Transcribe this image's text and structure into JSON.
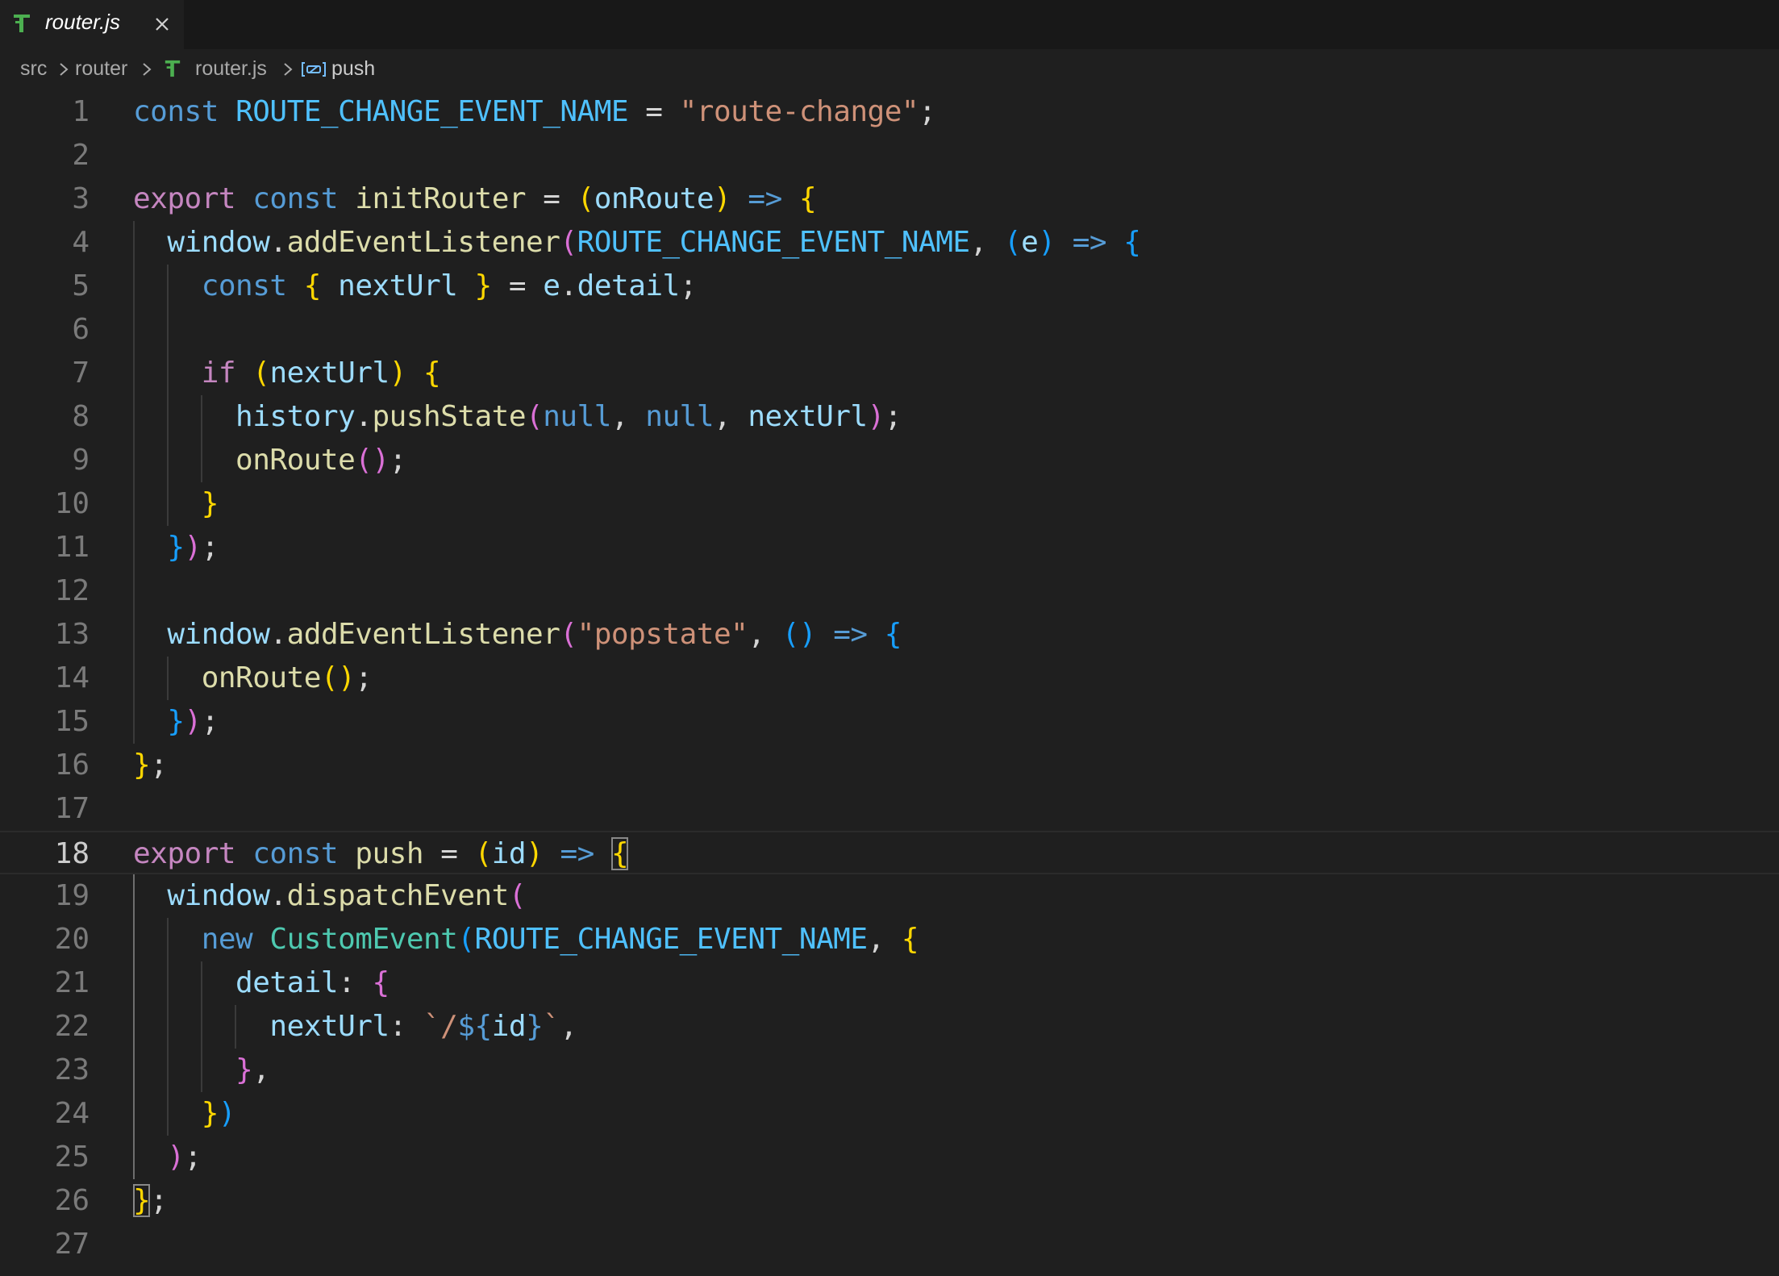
{
  "tab": {
    "title": "router.js",
    "icon": "js-file-icon",
    "close_icon": "close-icon"
  },
  "breadcrumb": {
    "items": [
      "src",
      "router",
      "router.js",
      "push"
    ],
    "separator_icon": "chevron-right-icon",
    "file_icon": "js-file-icon",
    "symbol_icon": "variable-symbol-icon"
  },
  "editor": {
    "language": "javascript",
    "current_line": 18,
    "lines": [
      {
        "n": "1",
        "text": "const ROUTE_CHANGE_EVENT_NAME = \"route-change\";"
      },
      {
        "n": "2",
        "text": ""
      },
      {
        "n": "3",
        "text": "export const initRouter = (onRoute) => {"
      },
      {
        "n": "4",
        "text": "  window.addEventListener(ROUTE_CHANGE_EVENT_NAME, (e) => {"
      },
      {
        "n": "5",
        "text": "    const { nextUrl } = e.detail;"
      },
      {
        "n": "6",
        "text": ""
      },
      {
        "n": "7",
        "text": "    if (nextUrl) {"
      },
      {
        "n": "8",
        "text": "      history.pushState(null, null, nextUrl);"
      },
      {
        "n": "9",
        "text": "      onRoute();"
      },
      {
        "n": "10",
        "text": "    }"
      },
      {
        "n": "11",
        "text": "  });"
      },
      {
        "n": "12",
        "text": ""
      },
      {
        "n": "13",
        "text": "  window.addEventListener(\"popstate\", () => {"
      },
      {
        "n": "14",
        "text": "    onRoute();"
      },
      {
        "n": "15",
        "text": "  });"
      },
      {
        "n": "16",
        "text": "};"
      },
      {
        "n": "17",
        "text": ""
      },
      {
        "n": "18",
        "text": "export const push = (id) => {"
      },
      {
        "n": "19",
        "text": "  window.dispatchEvent("
      },
      {
        "n": "20",
        "text": "    new CustomEvent(ROUTE_CHANGE_EVENT_NAME, {"
      },
      {
        "n": "21",
        "text": "      detail: {"
      },
      {
        "n": "22",
        "text": "        nextUrl: `/${id}`,"
      },
      {
        "n": "23",
        "text": "      },"
      },
      {
        "n": "24",
        "text": "    })"
      },
      {
        "n": "25",
        "text": "  );"
      },
      {
        "n": "26",
        "text": "};"
      },
      {
        "n": "27",
        "text": ""
      }
    ]
  },
  "colors": {
    "background": "#1f1f1f",
    "tabbar": "#181818",
    "keyword": "#569cd6",
    "control": "#c586c0",
    "constant": "#4fc1ff",
    "variable": "#9cdcfe",
    "function": "#dcdcaa",
    "string": "#ce9178",
    "class": "#4ec9b0",
    "bracket_1": "#ffd700",
    "bracket_2": "#da70d6",
    "bracket_3": "#179fff"
  }
}
